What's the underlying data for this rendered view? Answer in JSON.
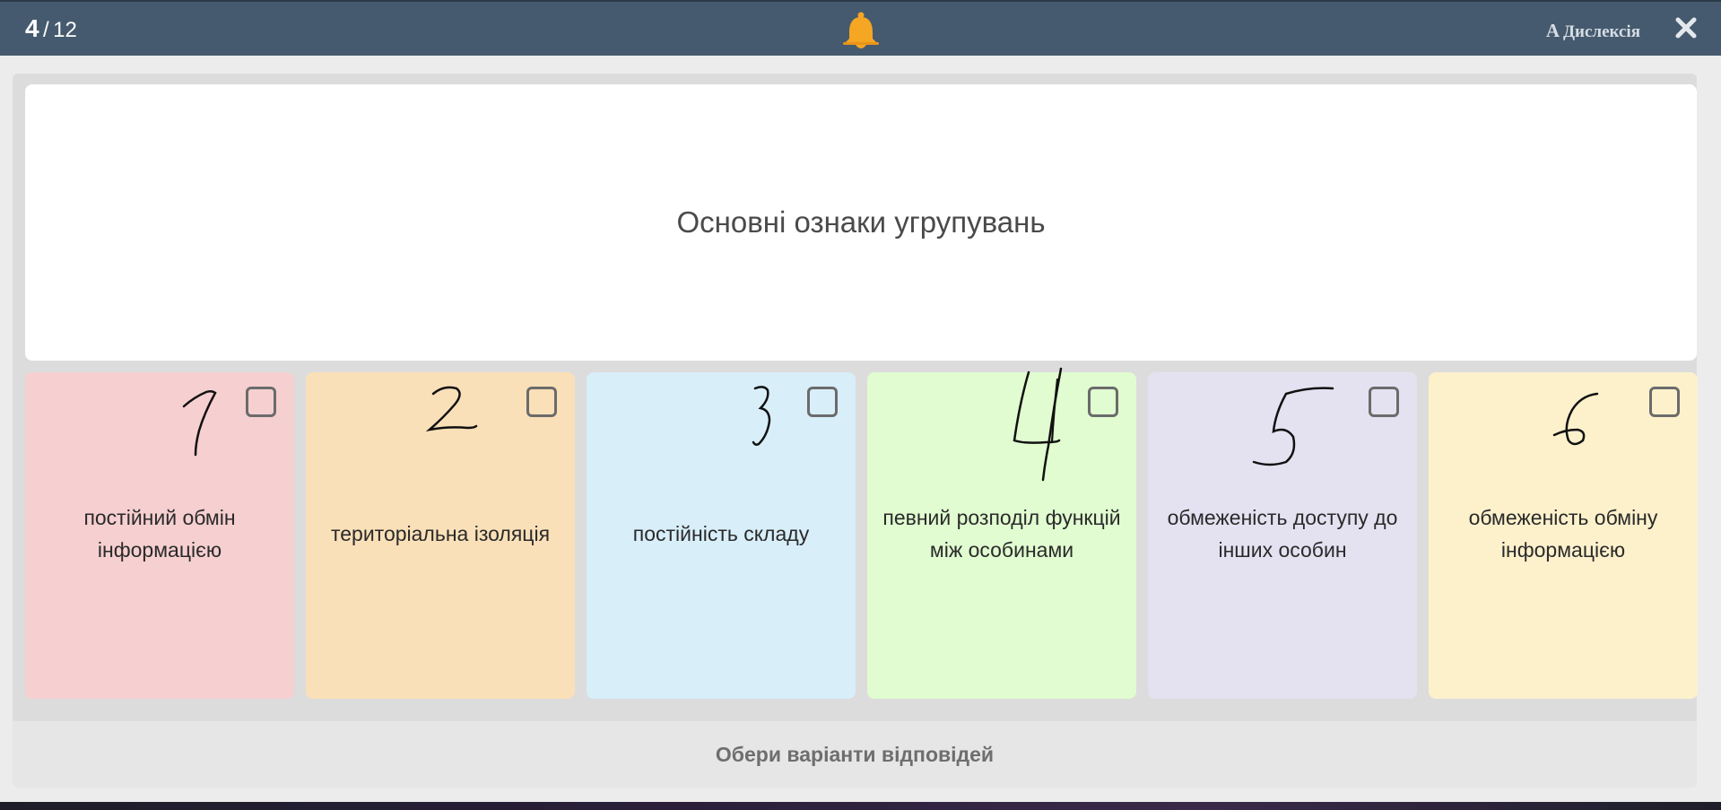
{
  "header": {
    "current": "4",
    "separator": "/",
    "total": "12",
    "dyslexia_glyph": "A",
    "dyslexia_label": "Дислексія",
    "bell_icon": "bell-icon",
    "close_icon": "close-icon",
    "bar_color": "#455a6e",
    "bell_color": "#f5a623"
  },
  "question": {
    "text": "Основні ознаки угрупувань"
  },
  "options": [
    {
      "label": "постійний обмін інформацією",
      "color": "#f6cfd0",
      "handwritten": "1"
    },
    {
      "label": "територіальна ізоляція",
      "color": "#fae0b8",
      "handwritten": "2"
    },
    {
      "label": "постійність складу",
      "color": "#d8eef9",
      "handwritten": "3"
    },
    {
      "label": "певний розподіл функцій між особинами",
      "color": "#e0fcd0",
      "handwritten": "4"
    },
    {
      "label": "обмеженість доступу до інших особин",
      "color": "#e4e2f1",
      "handwritten": "5"
    },
    {
      "label": "обмеженість обміну інформацією",
      "color": "#fdf1cc",
      "handwritten": "6"
    }
  ],
  "footer": {
    "prompt": "Обери варіанти відповідей"
  }
}
